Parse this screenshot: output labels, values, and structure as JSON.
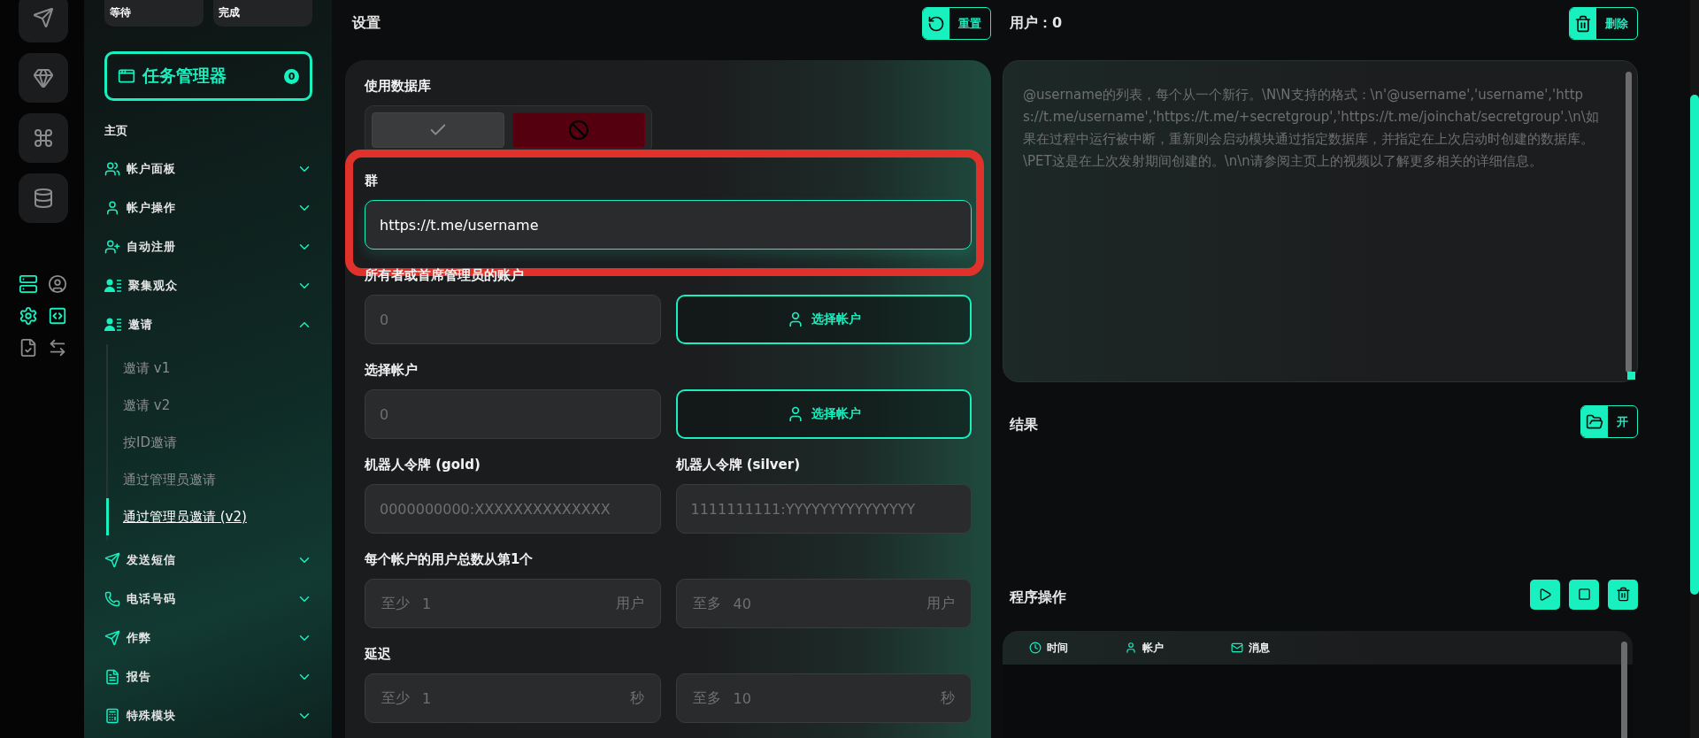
{
  "rail": {
    "tool_icons": [
      {
        "active": true
      },
      {
        "active": false
      },
      {
        "active": true
      },
      {
        "active": true
      },
      {
        "active": false
      },
      {
        "active": false
      }
    ]
  },
  "sidebar": {
    "status_cards": [
      "等待",
      "完成"
    ],
    "task_manager": {
      "label": "任务管理器",
      "count": "0"
    },
    "home": "主页",
    "menu": [
      {
        "label": "帐户面板",
        "expanded": false
      },
      {
        "label": "帐户操作",
        "expanded": false
      },
      {
        "label": "自动注册",
        "expanded": false
      },
      {
        "label": "聚集观众",
        "expanded": false
      },
      {
        "label": "邀请",
        "expanded": true,
        "children": [
          {
            "label": "邀请 v1",
            "selected": false
          },
          {
            "label": "邀请 v2",
            "selected": false
          },
          {
            "label": "按ID邀请",
            "selected": false
          },
          {
            "label": "通过管理员邀请",
            "selected": false
          },
          {
            "label": "通过管理员邀请 (v2)",
            "selected": true
          }
        ]
      },
      {
        "label": "发送短信",
        "expanded": false
      },
      {
        "label": "电话号码",
        "expanded": false
      },
      {
        "label": "作弊",
        "expanded": false
      },
      {
        "label": "报告",
        "expanded": false
      },
      {
        "label": "特殊模块",
        "expanded": false
      }
    ]
  },
  "settings": {
    "title": "设置",
    "reset_button": "重置",
    "use_database": {
      "label": "使用数据库",
      "enabled": false
    },
    "group": {
      "label": "群",
      "value": "https://t.me/username",
      "highlighted": true
    },
    "owner_accounts": {
      "label": "所有者或首席管理员的账户",
      "placeholder": "0",
      "button": "选择帐户"
    },
    "select_accounts": {
      "label": "选择帐户",
      "placeholder": "0",
      "button": "选择帐户"
    },
    "bot_tokens": [
      {
        "label": "机器人令牌 (gold)",
        "placeholder": "0000000000:XXXXXXXXXXXXXX"
      },
      {
        "label": "机器人令牌 (silver)",
        "placeholder": "1111111111:YYYYYYYYYYYYYYY"
      }
    ],
    "users_per_account": {
      "label": "每个帐户的用户总数从第1个",
      "min": {
        "prefix": "至少",
        "placeholder": "1",
        "unit": "用户"
      },
      "max": {
        "prefix": "至多",
        "placeholder": "40",
        "unit": "用户"
      }
    },
    "delay": {
      "label": "延迟",
      "min": {
        "prefix": "至少",
        "placeholder": "1",
        "unit": "秒"
      },
      "max": {
        "prefix": "至多",
        "placeholder": "10",
        "unit": "秒"
      }
    }
  },
  "users": {
    "title": "用户：0",
    "delete_button": "删除",
    "placeholder": "@username的列表，每个从一个新行。\\N\\N支持的格式：\\n'@username','username','https://t.me/username','https://t.me/+secretgroup','https://t.me/joinchat/secretgroup'.\\n\\如果在过程中运行被中断，重新则会启动模块通过指定数据库，并指定在上次启动时创建的数据库。\\PET这是在上次发射期间创建的。\\n\\n请参阅主页上的视频以了解更多相关的详细信息。"
  },
  "results": {
    "title": "结果",
    "open_button": "开"
  },
  "operations": {
    "title": "程序操作",
    "columns": [
      "时间",
      "帐户",
      "消息"
    ]
  }
}
